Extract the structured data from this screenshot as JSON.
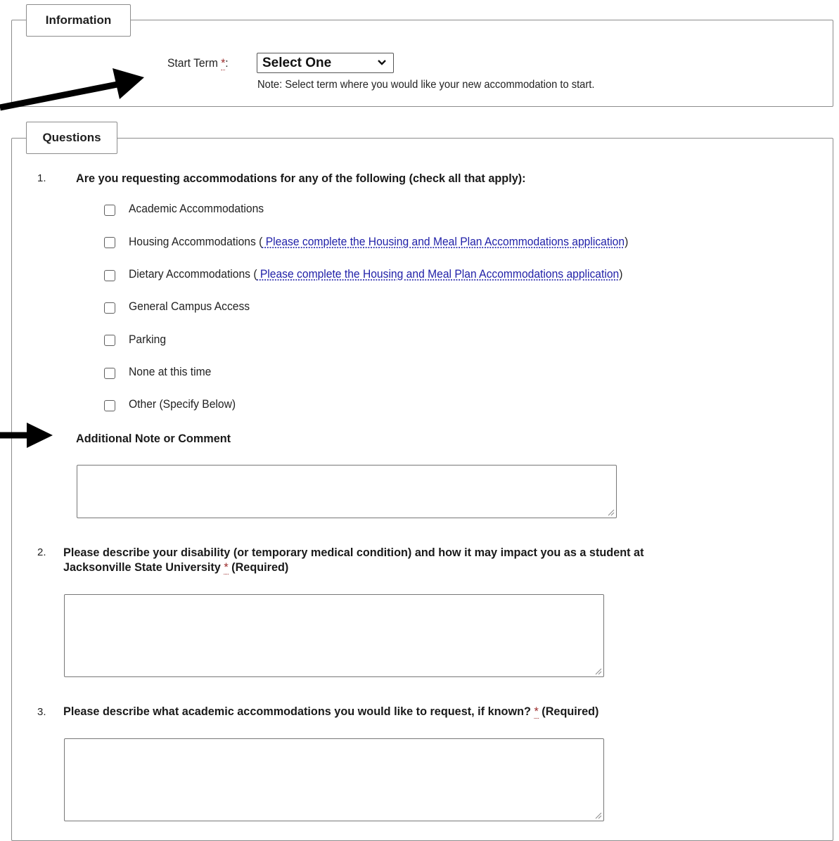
{
  "information": {
    "legend": "Information",
    "start_term_label": "Start Term",
    "required_mark": "*",
    "colon": ":",
    "start_term_selected": "Select One",
    "note": "Note: Select term where you would like your new accommodation to start."
  },
  "questions": {
    "legend": "Questions",
    "q1": {
      "number": "1.",
      "text": "Are you requesting accommodations for any of the following (check all that apply):",
      "options": [
        {
          "label": "Academic Accommodations"
        },
        {
          "label": "Housing Accommodations (",
          "link": " Please complete the Housing and Meal Plan Accommodations application",
          "after": ")"
        },
        {
          "label": "Dietary Accommodations (",
          "link": " Please complete the Housing and Meal Plan Accommodations application",
          "after": ")"
        },
        {
          "label": "General Campus Access"
        },
        {
          "label": "Parking"
        },
        {
          "label": "None at this time"
        },
        {
          "label": "Other (Specify Below)"
        }
      ],
      "comment_label": "Additional Note or Comment"
    },
    "q2": {
      "number": "2.",
      "line1": "Please describe your disability (or temporary medical condition) and how it may impact you as a student at",
      "line2": "Jacksonville State University",
      "required_mark": "*",
      "required_text": "(Required)"
    },
    "q3": {
      "number": "3.",
      "text": "Please describe what academic accommodations you would like to request, if known?",
      "required_mark": "*",
      "required_text": "(Required)"
    }
  },
  "colors": {
    "link": "#1f1fa8",
    "required": "#9a2a2a",
    "border": "#8c8c8c",
    "arrow": "#000000"
  }
}
